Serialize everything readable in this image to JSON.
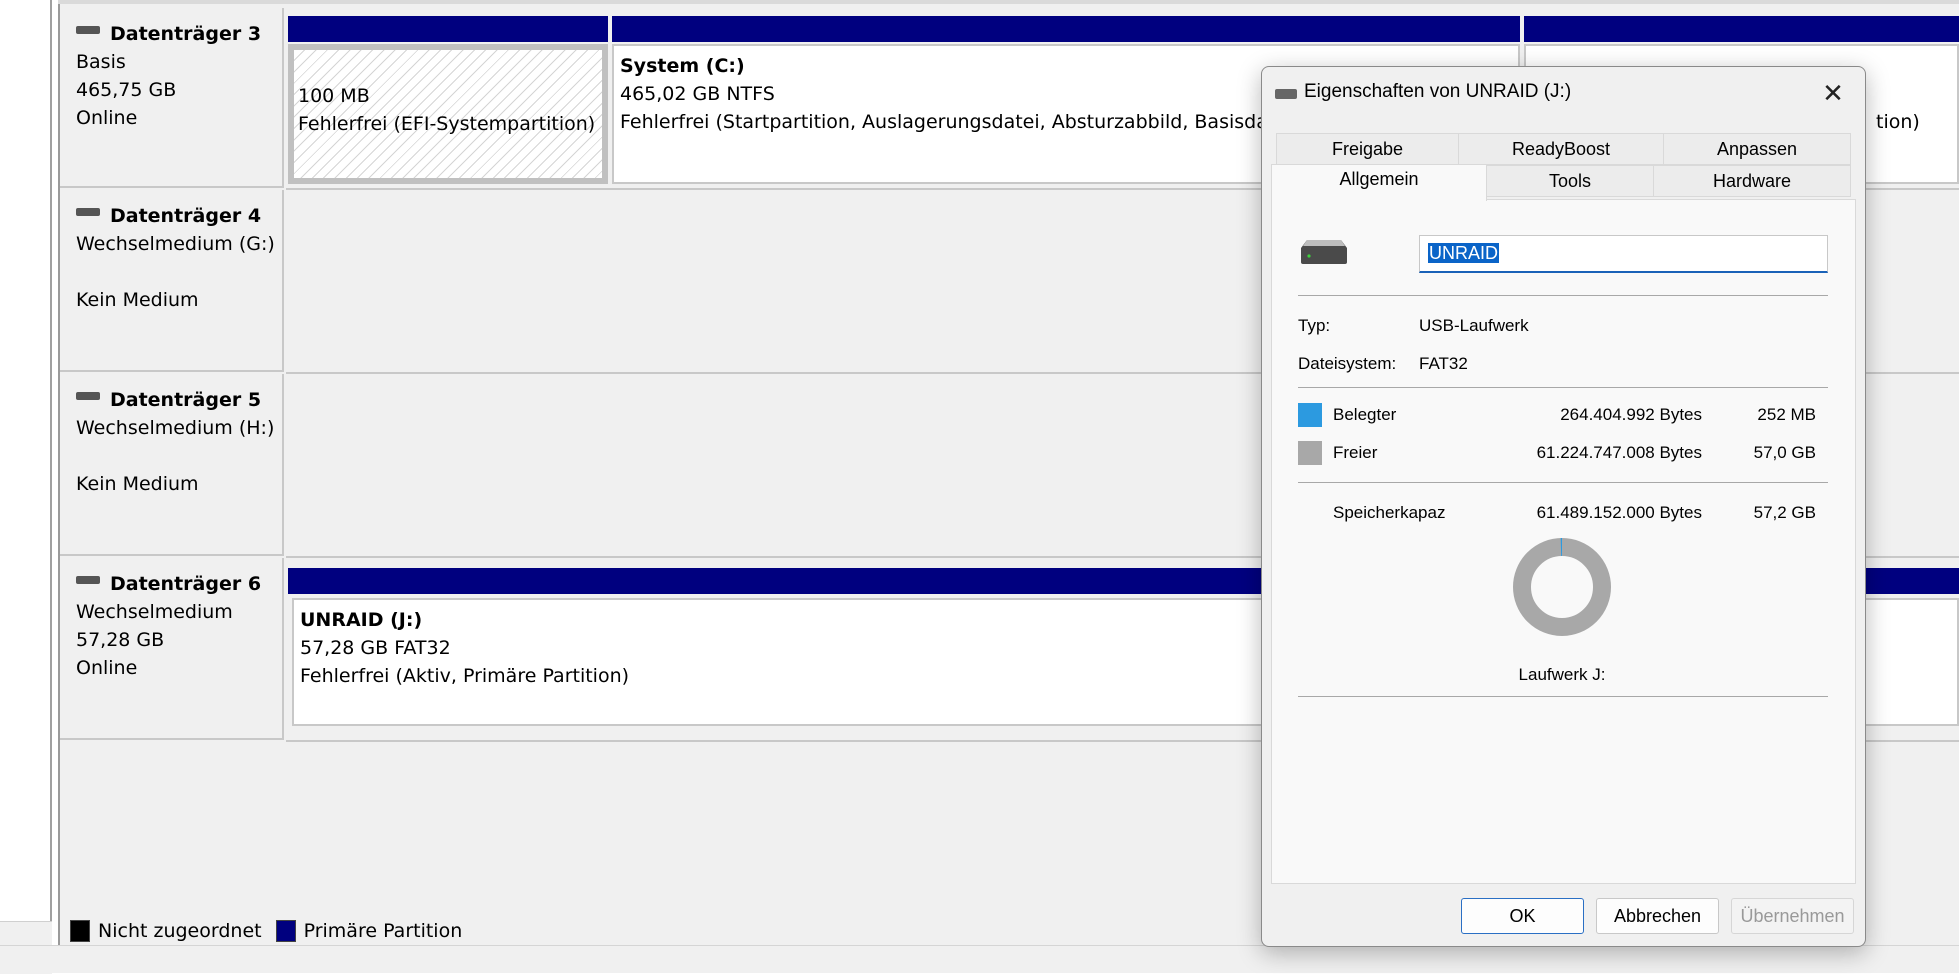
{
  "disks": [
    {
      "title": "Datenträger 3",
      "lines": [
        "Basis",
        "465,75 GB",
        "Online"
      ]
    },
    {
      "title": "Datenträger 4",
      "lines": [
        "Wechselmedium (G:)",
        "",
        "Kein Medium"
      ]
    },
    {
      "title": "Datenträger 5",
      "lines": [
        "Wechselmedium (H:)",
        "",
        "Kein Medium"
      ]
    },
    {
      "title": "Datenträger 6",
      "lines": [
        "Wechselmedium",
        "57,28 GB",
        "Online"
      ]
    }
  ],
  "partitions": {
    "efi": {
      "size": "100 MB",
      "status": "Fehlerfrei (EFI-Systempartition)"
    },
    "system": {
      "name": "System  (C:)",
      "size": "465,02 GB NTFS",
      "status": "Fehlerfrei (Startpartition, Auslagerungsdatei, Absturzabbild, Basisdatenpartition)"
    },
    "third": {
      "status": "tion)"
    },
    "unraid": {
      "name": "UNRAID  (J:)",
      "size": "57,28 GB FAT32",
      "status": "Fehlerfrei (Aktiv, Primäre Partition)"
    }
  },
  "legend": {
    "unallocated": "Nicht zugeordnet",
    "primary": "Primäre Partition"
  },
  "dialog": {
    "title": "Eigenschaften von UNRAID (J:)",
    "close_glyph": "✕",
    "tabs_top": [
      "Freigabe",
      "ReadyBoost",
      "Anpassen"
    ],
    "tabs_bottom": [
      "Allgemein",
      "Tools",
      "Hardware"
    ],
    "drive_name": "UNRAID",
    "type_label": "Typ:",
    "type_value": "USB-Laufwerk",
    "fs_label": "Dateisystem:",
    "fs_value": "FAT32",
    "used_label": "Belegter",
    "used_bytes": "264.404.992 Bytes",
    "used_size": "252 MB",
    "free_label": "Freier",
    "free_bytes": "61.224.747.008 Bytes",
    "free_size": "57,0 GB",
    "cap_label": "Speicherkapaz",
    "cap_bytes": "61.489.152.000 Bytes",
    "cap_size": "57,2 GB",
    "drive_label": "Laufwerk J:",
    "used_fraction": 0.0043,
    "colors": {
      "used": "#2c9ae0",
      "free": "#a8a8a8"
    },
    "buttons": {
      "ok": "OK",
      "cancel": "Abbrechen",
      "apply": "Übernehmen"
    }
  }
}
